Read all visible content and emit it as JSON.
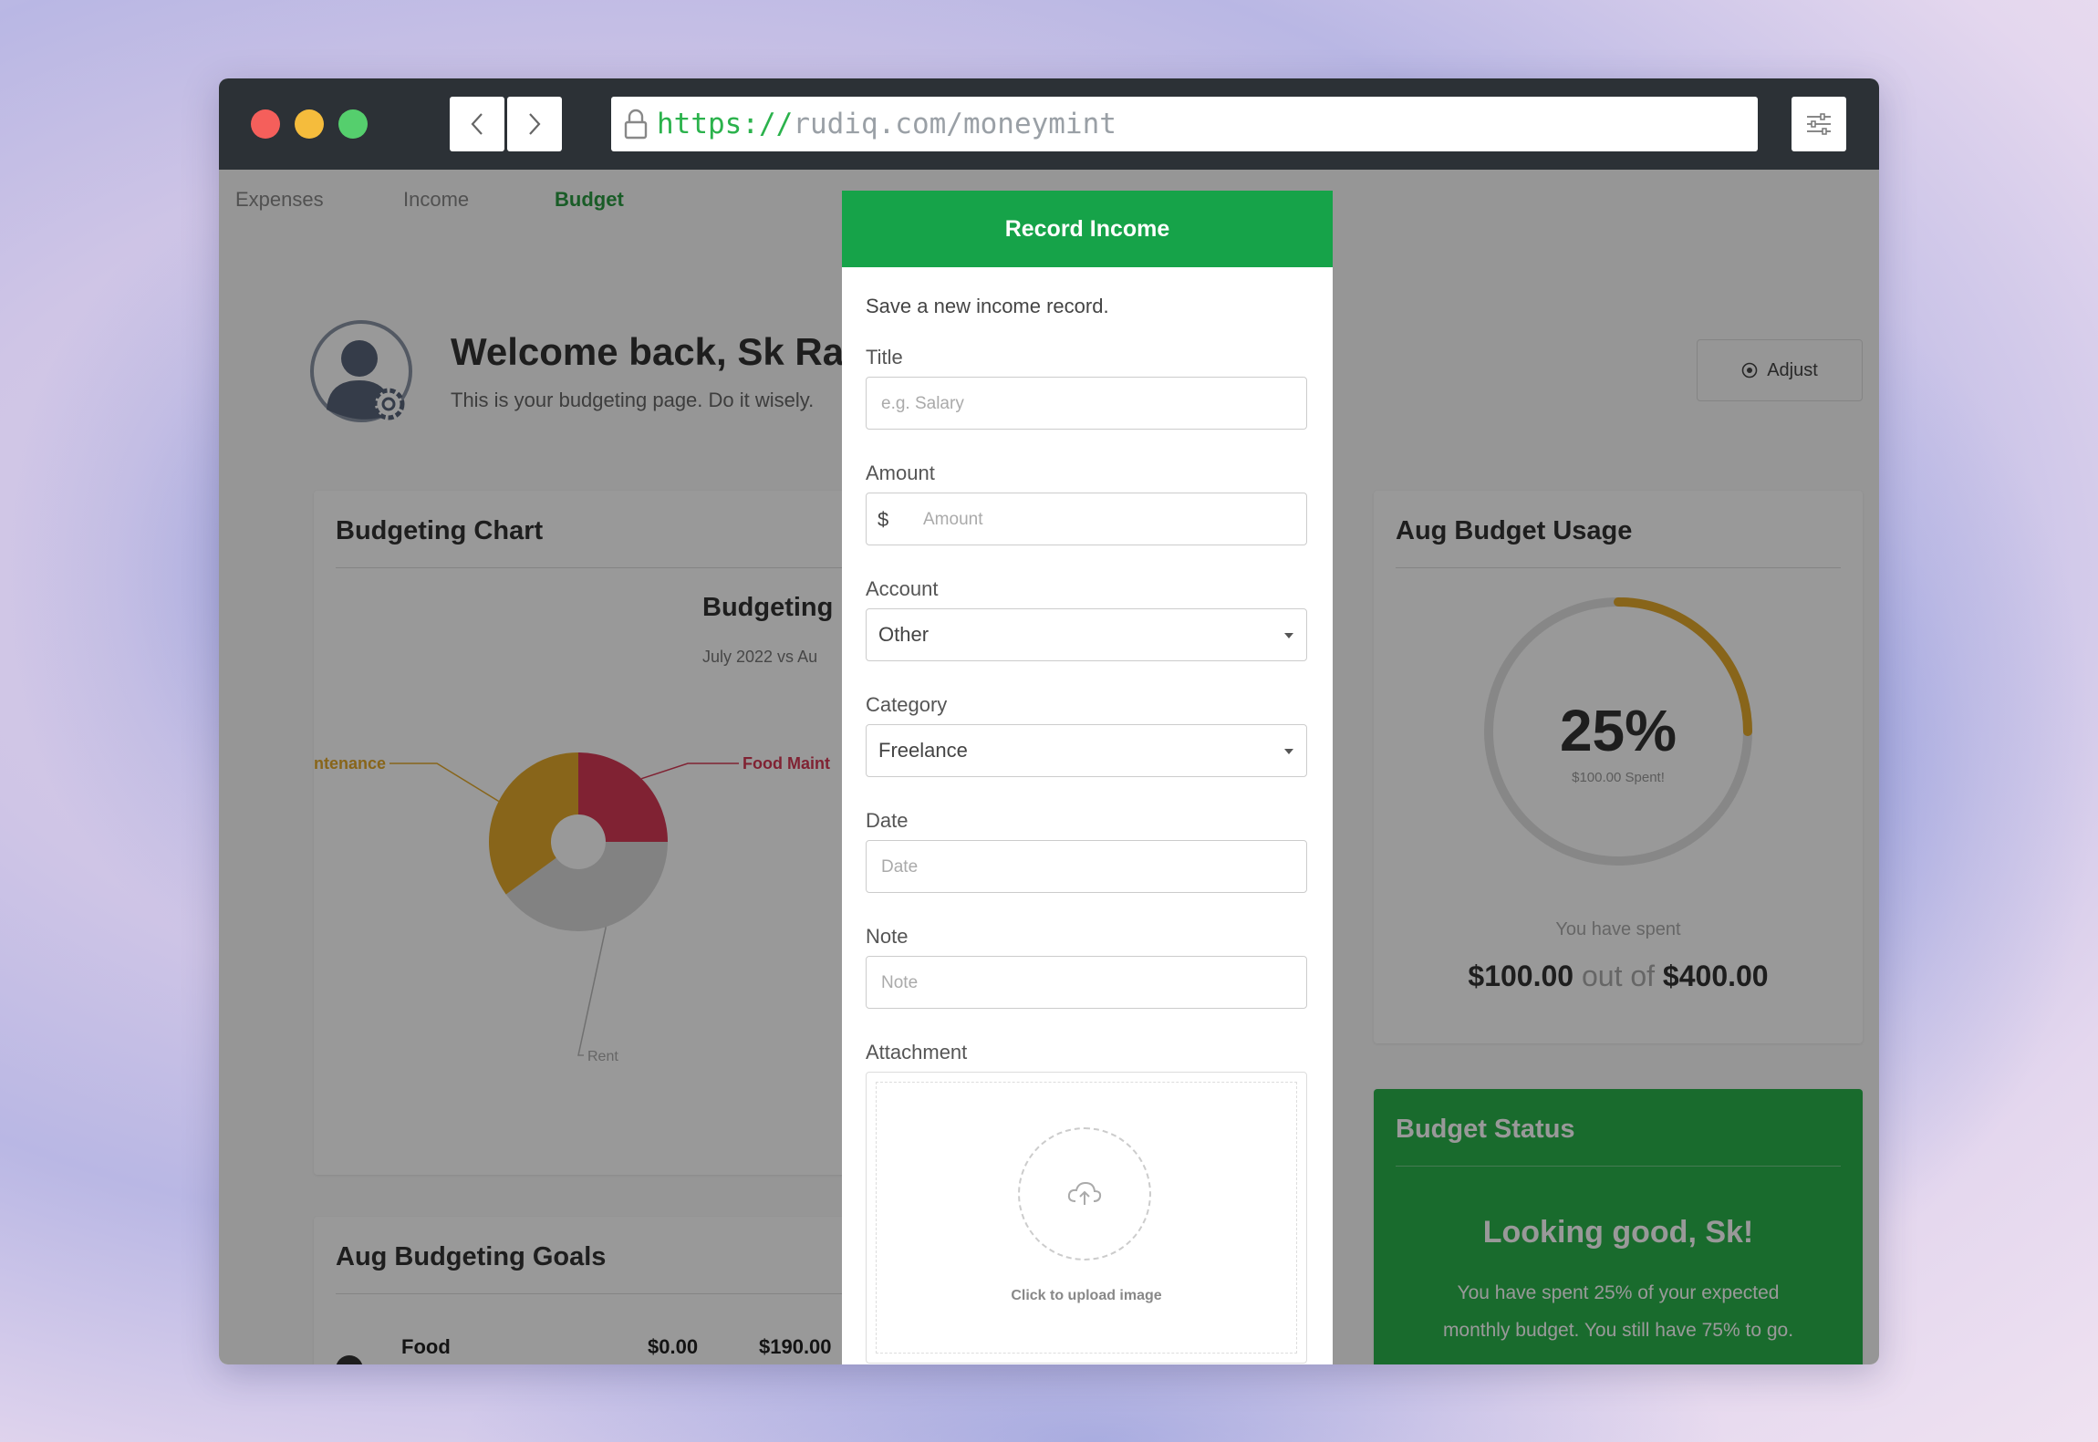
{
  "browser": {
    "url_scheme": "https://",
    "url_rest": "rudiq.com/moneymint"
  },
  "nav": {
    "tabs": [
      {
        "label": "Expenses"
      },
      {
        "label": "Income"
      },
      {
        "label": "Budget"
      }
    ]
  },
  "header": {
    "welcome": "Welcome back, Sk Rab",
    "subtitle": "This is your budgeting page. Do it wisely.",
    "adjust_label": "Adjust"
  },
  "chart_card": {
    "title": "Budgeting Chart",
    "chart_title": "Budgeting",
    "chart_subtitle": "July 2022 vs Au"
  },
  "chart_data": {
    "type": "pie",
    "labels": [
      "Food Maint",
      "Rent",
      "ntenance"
    ],
    "values": [
      25,
      40,
      35
    ],
    "colors": [
      "#d63a55",
      "#d9d9d9",
      "#e3a92c"
    ]
  },
  "goals_card": {
    "title": "Aug Budgeting Goals",
    "rows": [
      {
        "name": "Food",
        "spent": "$0.00",
        "goal": "$190.00"
      }
    ]
  },
  "usage_card": {
    "title": "Aug Budget Usage",
    "percent": 25,
    "percent_label": "25%",
    "percent_sub": "$100.00 Spent!",
    "spent_caption": "You have spent",
    "spent": "$100.00",
    "out_of": "out of",
    "total": "$400.00",
    "ring_color": "#e3a92c",
    "track_color": "#e2e2e2"
  },
  "status_card": {
    "title": "Budget Status",
    "headline": "Looking good, Sk!",
    "message_line1": "You have spent 25% of your expected",
    "message_line2": "monthly budget. You still have 75% to go."
  },
  "modal": {
    "title": "Record Income",
    "subtitle": "Save a new income record.",
    "fields": {
      "title": {
        "label": "Title",
        "placeholder": "e.g. Salary"
      },
      "amount": {
        "label": "Amount",
        "prefix": "$",
        "placeholder": "Amount"
      },
      "account": {
        "label": "Account",
        "value": "Other"
      },
      "category": {
        "label": "Category",
        "value": "Freelance"
      },
      "date": {
        "label": "Date",
        "placeholder": "Date"
      },
      "note": {
        "label": "Note",
        "placeholder": "Note"
      },
      "attachment": {
        "label": "Attachment",
        "upload_text": "Click to upload image"
      }
    }
  },
  "colors": {
    "accent_green": "#16a349",
    "tab_active": "#2b9a42",
    "status_green": "#2bb24c"
  }
}
